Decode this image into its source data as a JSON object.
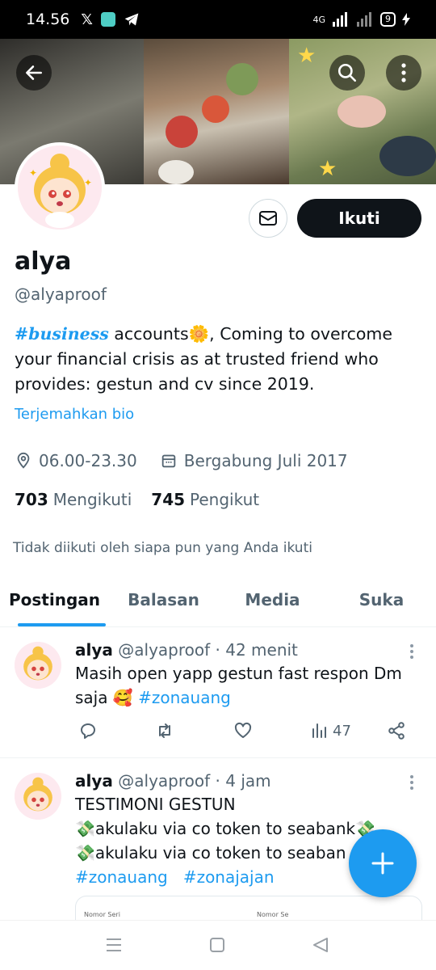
{
  "status_bar": {
    "time": "14.56",
    "network": "4G",
    "battery": "9"
  },
  "profile": {
    "name": "alya",
    "handle": "@alyaproof",
    "bio_hashtag": "#business",
    "bio_text": " accounts🌼, Coming to overcome your financial crisis as at trusted friend who provides: gestun and cv since 2019.",
    "translate_label": "Terjemahkan bio",
    "location": "06.00-23.30",
    "joined": "Bergabung Juli 2017",
    "following_count": "703",
    "following_label": "Mengikuti",
    "followers_count": "745",
    "followers_label": "Pengikut",
    "not_followed_note": "Tidak diikuti oleh siapa pun yang Anda ikuti",
    "follow_label": "Ikuti"
  },
  "tabs": [
    "Postingan",
    "Balasan",
    "Media",
    "Suka"
  ],
  "active_tab": "Postingan",
  "tweets": [
    {
      "name": "alya",
      "handle": "@alyaproof",
      "time": "· 42 menit",
      "text": "Masih open yapp gestun fast respon Dm saja 🥰",
      "hashtag": "#zonauang",
      "views": "47"
    },
    {
      "name": "alya",
      "handle": "@alyaproof",
      "time": "· 4 jam",
      "line1": "TESTIMONI GESTUN",
      "line2": "💸akulaku via co token to seabank💸",
      "line3": "💸akulaku via co token to seaban",
      "hashtag1": "#zonauang",
      "hashtag2": "#zonajajan",
      "preview_left": "Nomor Seri",
      "preview_right": "Nomor Se"
    }
  ],
  "colors": {
    "accent": "#1d9bf0",
    "text": "#0f1419",
    "muted": "#536471",
    "follow_bg": "#0f1419"
  }
}
